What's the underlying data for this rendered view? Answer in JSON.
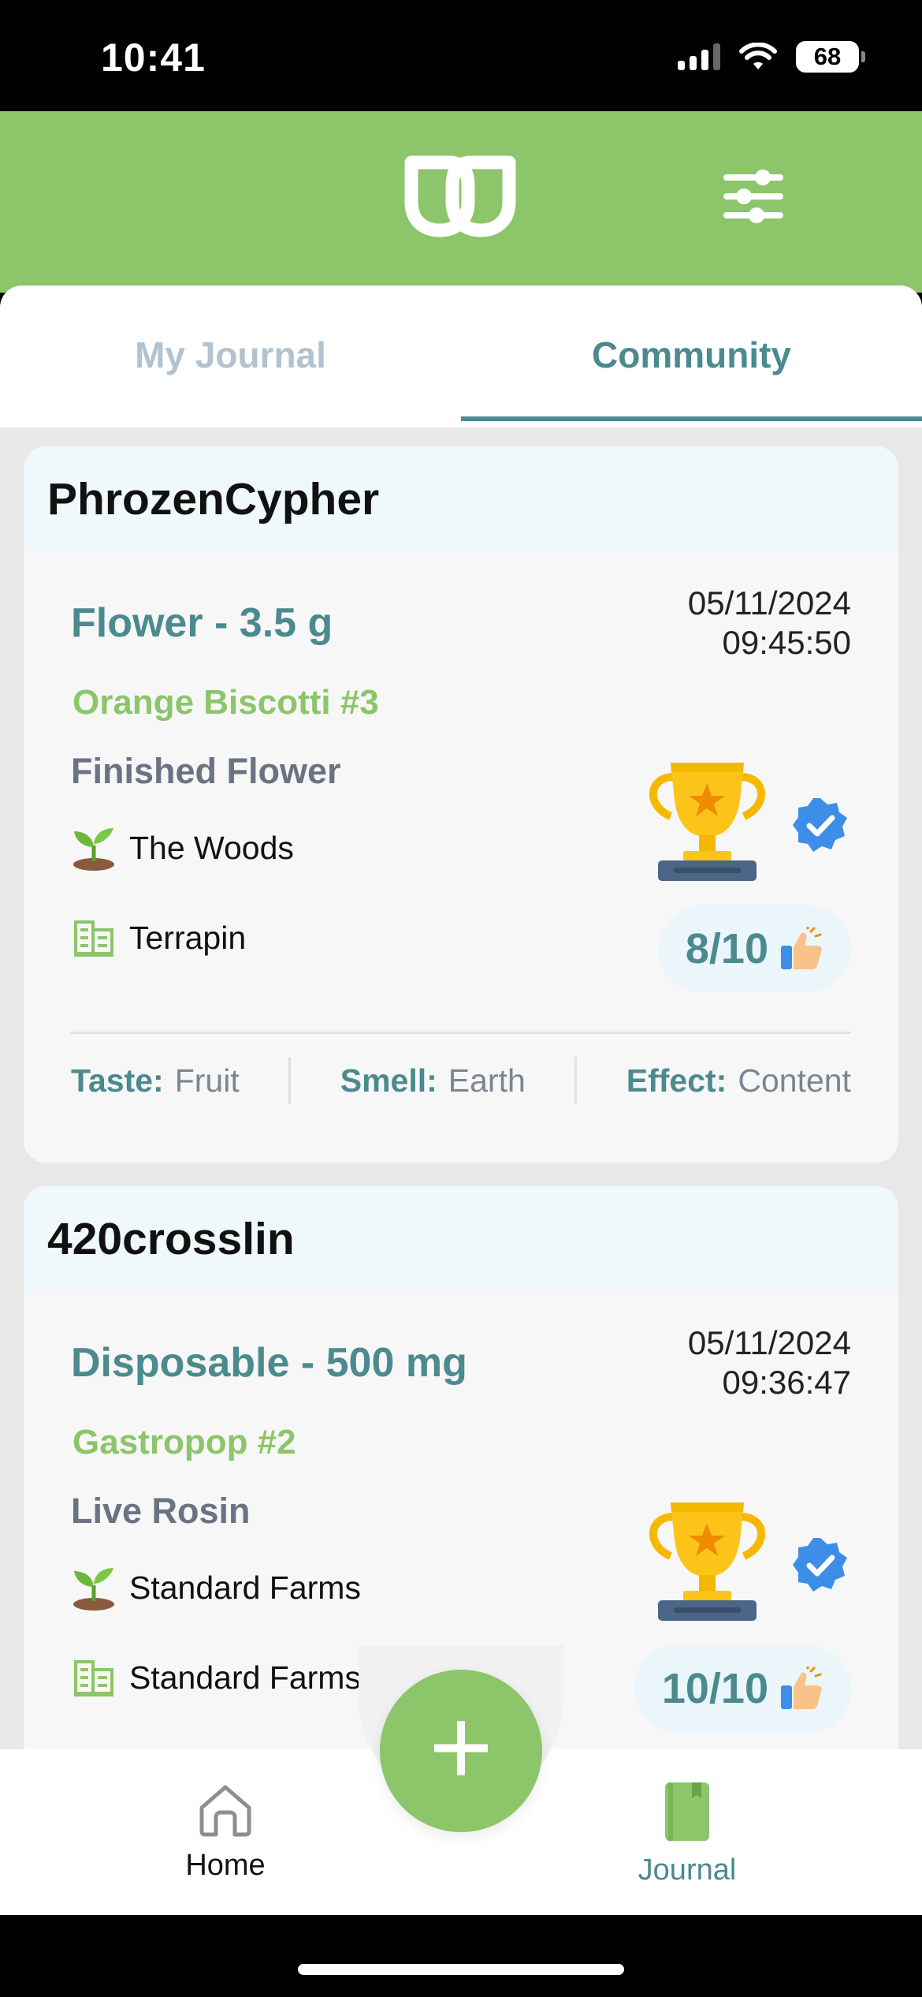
{
  "status_bar": {
    "time": "10:41",
    "battery": "68"
  },
  "tabs": [
    {
      "label": "My Journal",
      "active": false
    },
    {
      "label": "Community",
      "active": true
    }
  ],
  "entries": [
    {
      "user": "PhrozenCypher",
      "product": "Flower - 3.5 g",
      "date": "05/11/2024",
      "time": "09:45:50",
      "strain": "Orange Biscotti #3",
      "type": "Finished Flower",
      "grower": "The Woods",
      "brand": "Terrapin",
      "rating": "8/10",
      "notes": {
        "taste_label": "Taste:",
        "taste": "Fruit",
        "smell_label": "Smell:",
        "smell": "Earth",
        "effect_label": "Effect:",
        "effect": "Content"
      }
    },
    {
      "user": "420crosslin",
      "product": "Disposable - 500 mg",
      "date": "05/11/2024",
      "time": "09:36:47",
      "strain": "Gastropop #2",
      "type": "Live Rosin",
      "grower": "Standard Farms",
      "brand": "Standard Farms",
      "rating": "10/10"
    }
  ],
  "nav": {
    "home_label": "Home",
    "journal_label": "Journal",
    "fab_symbol": "+"
  },
  "colors": {
    "brand_green": "#8cc56a",
    "teal": "#4b8a8e",
    "inactive_tab": "#b3c2cf"
  }
}
